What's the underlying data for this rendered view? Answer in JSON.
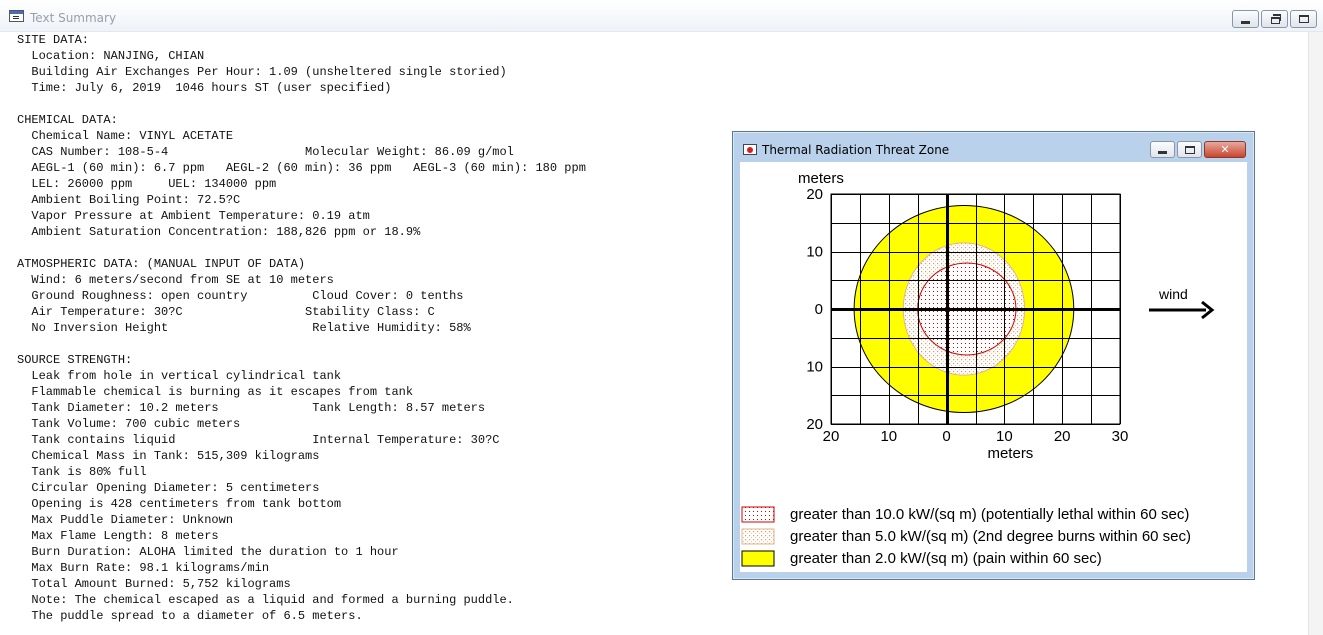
{
  "main_window": {
    "title": "Text Summary",
    "lines": [
      "SITE DATA:",
      "  Location: NANJING, CHIAN",
      "  Building Air Exchanges Per Hour: 1.09 (unsheltered single storied)",
      "  Time: July 6, 2019  1046 hours ST (user specified)",
      "",
      "CHEMICAL DATA:",
      "  Chemical Name: VINYL ACETATE",
      "  CAS Number: 108-5-4                   Molecular Weight: 86.09 g/mol",
      "  AEGL-1 (60 min): 6.7 ppm   AEGL-2 (60 min): 36 ppm   AEGL-3 (60 min): 180 ppm",
      "  LEL: 26000 ppm     UEL: 134000 ppm",
      "  Ambient Boiling Point: 72.5?C",
      "  Vapor Pressure at Ambient Temperature: 0.19 atm",
      "  Ambient Saturation Concentration: 188,826 ppm or 18.9%",
      "",
      "ATMOSPHERIC DATA: (MANUAL INPUT OF DATA)",
      "  Wind: 6 meters/second from SE at 10 meters",
      "  Ground Roughness: open country         Cloud Cover: 0 tenths",
      "  Air Temperature: 30?C                 Stability Class: C",
      "  No Inversion Height                    Relative Humidity: 58%",
      "",
      "SOURCE STRENGTH:",
      "  Leak from hole in vertical cylindrical tank",
      "  Flammable chemical is burning as it escapes from tank",
      "  Tank Diameter: 10.2 meters             Tank Length: 8.57 meters",
      "  Tank Volume: 700 cubic meters",
      "  Tank contains liquid                   Internal Temperature: 30?C",
      "  Chemical Mass in Tank: 515,309 kilograms",
      "  Tank is 80% full",
      "  Circular Opening Diameter: 5 centimeters",
      "  Opening is 428 centimeters from tank bottom",
      "  Max Puddle Diameter: Unknown",
      "  Max Flame Length: 8 meters",
      "  Burn Duration: ALOHA limited the duration to 1 hour",
      "  Max Burn Rate: 98.1 kilograms/min",
      "  Total Amount Burned: 5,752 kilograms",
      "  Note: The chemical escaped as a liquid and formed a burning puddle.",
      "  The puddle spread to a diameter of 6.5 meters."
    ]
  },
  "threat_zone_window": {
    "title": "Thermal Radiation Threat Zone",
    "wind_label": "wind",
    "colors": {
      "red_zone": "#d40000",
      "orange_zone": "#e6b486",
      "yellow_zone": "#ffff00",
      "grid": "#000000"
    }
  },
  "chart_data": {
    "type": "threat-zone-plot",
    "y_unit_label": "meters",
    "x_unit_label": "meters",
    "x_range": [
      -20,
      30
    ],
    "y_range": [
      -20,
      20
    ],
    "x_tick_labels": [
      "20",
      "10",
      "0",
      "10",
      "20",
      "30"
    ],
    "y_tick_labels": [
      "20",
      "10",
      "0",
      "10",
      "20"
    ],
    "x_ticks": [
      -20,
      -10,
      0,
      10,
      20,
      30
    ],
    "y_ticks": [
      20,
      10,
      0,
      -10,
      -20
    ],
    "zones": [
      {
        "label": "greater than 2.0 kW/(sq m) (pain within 60 sec)",
        "color": "#ffff00",
        "fill": "solid",
        "cx": 3,
        "cy": 0,
        "rx": 19,
        "ry": 18
      },
      {
        "label": "greater than 5.0 kW/(sq m) (2nd degree burns within 60 sec)",
        "color": "#e6b486",
        "fill": "dots",
        "cx": 3,
        "cy": 0,
        "rx": 10.5,
        "ry": 11.5
      },
      {
        "label": "greater than 10.0 kW/(sq m) (potentially lethal within 60 sec)",
        "color": "#d40000",
        "fill": "dots",
        "cx": 3.5,
        "cy": 0,
        "rx": 8.5,
        "ry": 8
      }
    ],
    "legend": [
      {
        "label": "greater than 10.0 kW/(sq m) (potentially lethal within 60 sec)",
        "color": "#d40000",
        "fill": "dots"
      },
      {
        "label": "greater than 5.0 kW/(sq m) (2nd degree burns within 60 sec)",
        "color": "#e6b486",
        "fill": "dots"
      },
      {
        "label": "greater than 2.0 kW/(sq m) (pain within 60 sec)",
        "color": "#ffff00",
        "fill": "solid"
      }
    ],
    "wind_direction": "right"
  }
}
